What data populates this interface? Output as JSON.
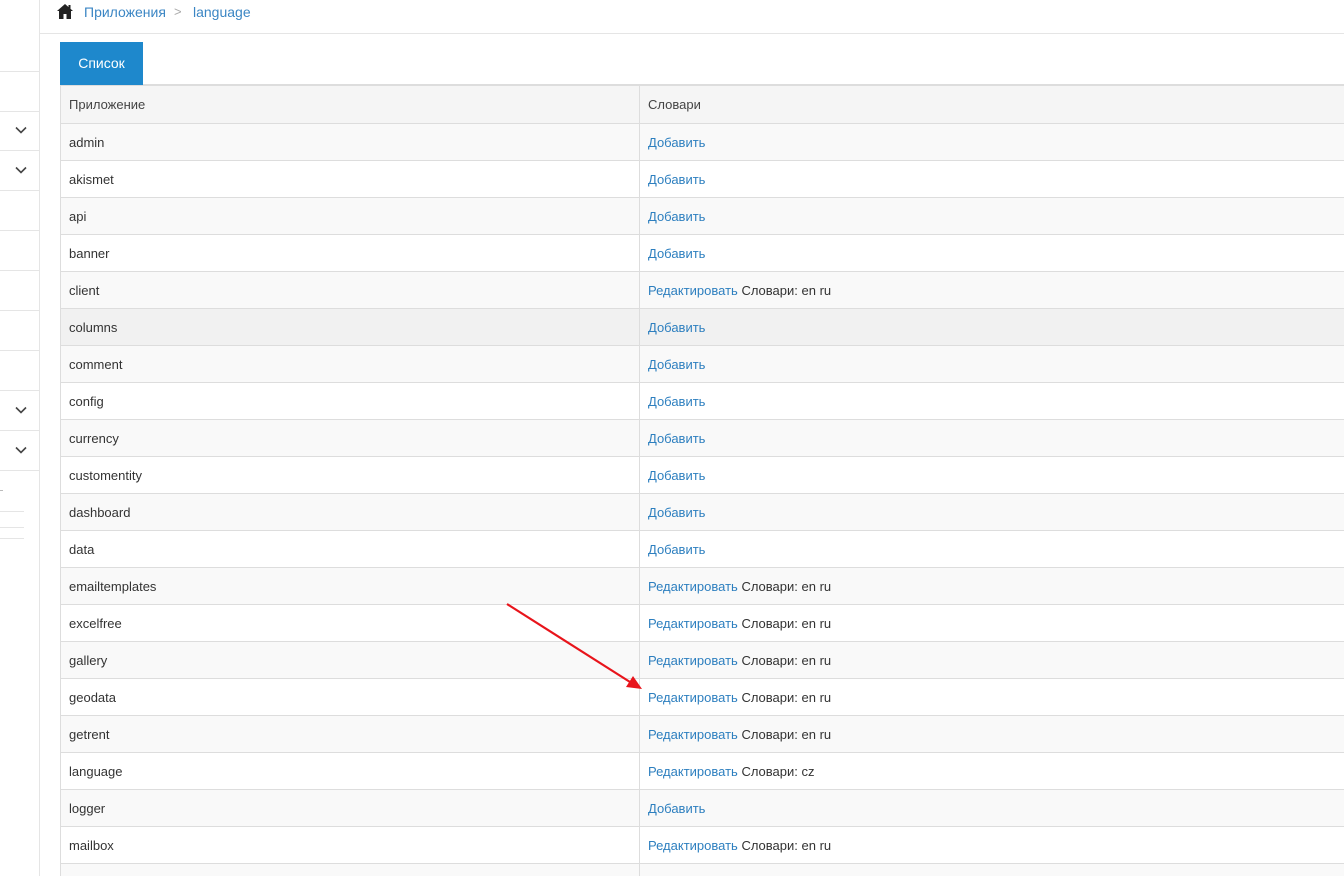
{
  "breadcrumb": {
    "home_icon": "home-icon",
    "items": [
      "Приложения",
      "language"
    ],
    "separator": ">"
  },
  "tab": {
    "label": "Список"
  },
  "table": {
    "headers": [
      "Приложение",
      "Словари"
    ],
    "rows": [
      {
        "app": "admin",
        "action": "Добавить",
        "dicts": ""
      },
      {
        "app": "akismet",
        "action": "Добавить",
        "dicts": ""
      },
      {
        "app": "api",
        "action": "Добавить",
        "dicts": ""
      },
      {
        "app": "banner",
        "action": "Добавить",
        "dicts": ""
      },
      {
        "app": "client",
        "action": "Редактировать",
        "dicts": "Словари: en ru"
      },
      {
        "app": "columns",
        "action": "Добавить",
        "dicts": ""
      },
      {
        "app": "comment",
        "action": "Добавить",
        "dicts": ""
      },
      {
        "app": "config",
        "action": "Добавить",
        "dicts": ""
      },
      {
        "app": "currency",
        "action": "Добавить",
        "dicts": ""
      },
      {
        "app": "customentity",
        "action": "Добавить",
        "dicts": ""
      },
      {
        "app": "dashboard",
        "action": "Добавить",
        "dicts": ""
      },
      {
        "app": "data",
        "action": "Добавить",
        "dicts": ""
      },
      {
        "app": "emailtemplates",
        "action": "Редактировать",
        "dicts": "Словари: en ru"
      },
      {
        "app": "excelfree",
        "action": "Редактировать",
        "dicts": "Словари: en ru"
      },
      {
        "app": "gallery",
        "action": "Редактировать",
        "dicts": "Словари: en ru"
      },
      {
        "app": "geodata",
        "action": "Редактировать",
        "dicts": "Словари: en ru"
      },
      {
        "app": "getrent",
        "action": "Редактировать",
        "dicts": "Словари: en ru"
      },
      {
        "app": "language",
        "action": "Редактировать",
        "dicts": "Словари: cz"
      },
      {
        "app": "logger",
        "action": "Добавить",
        "dicts": ""
      },
      {
        "app": "mailbox",
        "action": "Редактировать",
        "dicts": "Словари: en ru"
      },
      {
        "app": "",
        "action": "",
        "dicts": ""
      }
    ]
  },
  "colors": {
    "accent": "#1e88cc",
    "link": "#2d7fbf",
    "annotation_arrow": "#e8141b"
  }
}
